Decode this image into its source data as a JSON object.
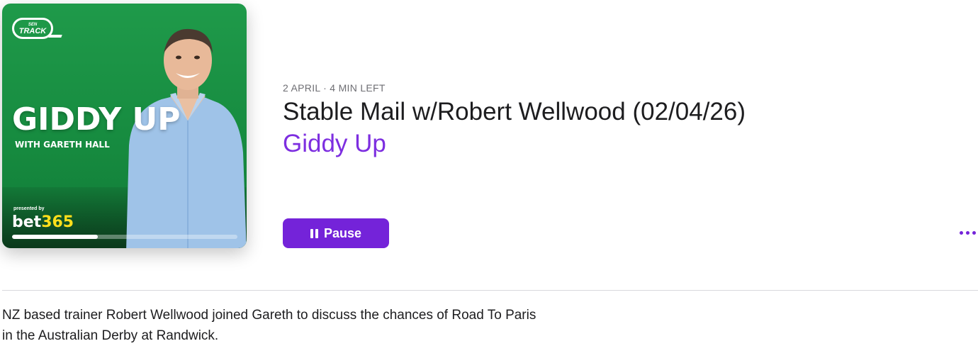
{
  "artwork": {
    "logo_text": "TRACK",
    "logo_small": "SEN",
    "title": "GIDDY UP",
    "subtitle": "WITH GARETH HALL",
    "presented_by": "presented by",
    "sponsor_a": "bet",
    "sponsor_b": "365",
    "playback_progress": 0.38
  },
  "episode": {
    "meta": "2 APRIL · 4 MIN LEFT",
    "title": "Stable Mail w/Robert Wellwood (02/04/26)",
    "show": "Giddy Up",
    "pause_label": "Pause",
    "description": "NZ based trainer Robert Wellwood joined Gareth to discuss the chances of Road To Paris in the Australian Derby at Randwick."
  },
  "colors": {
    "accent": "#7423d9",
    "show_link": "#7d2ee0",
    "artwork_green": "#1f9a4a"
  },
  "icons": {
    "pause": "pause-icon",
    "more": "more-icon"
  }
}
